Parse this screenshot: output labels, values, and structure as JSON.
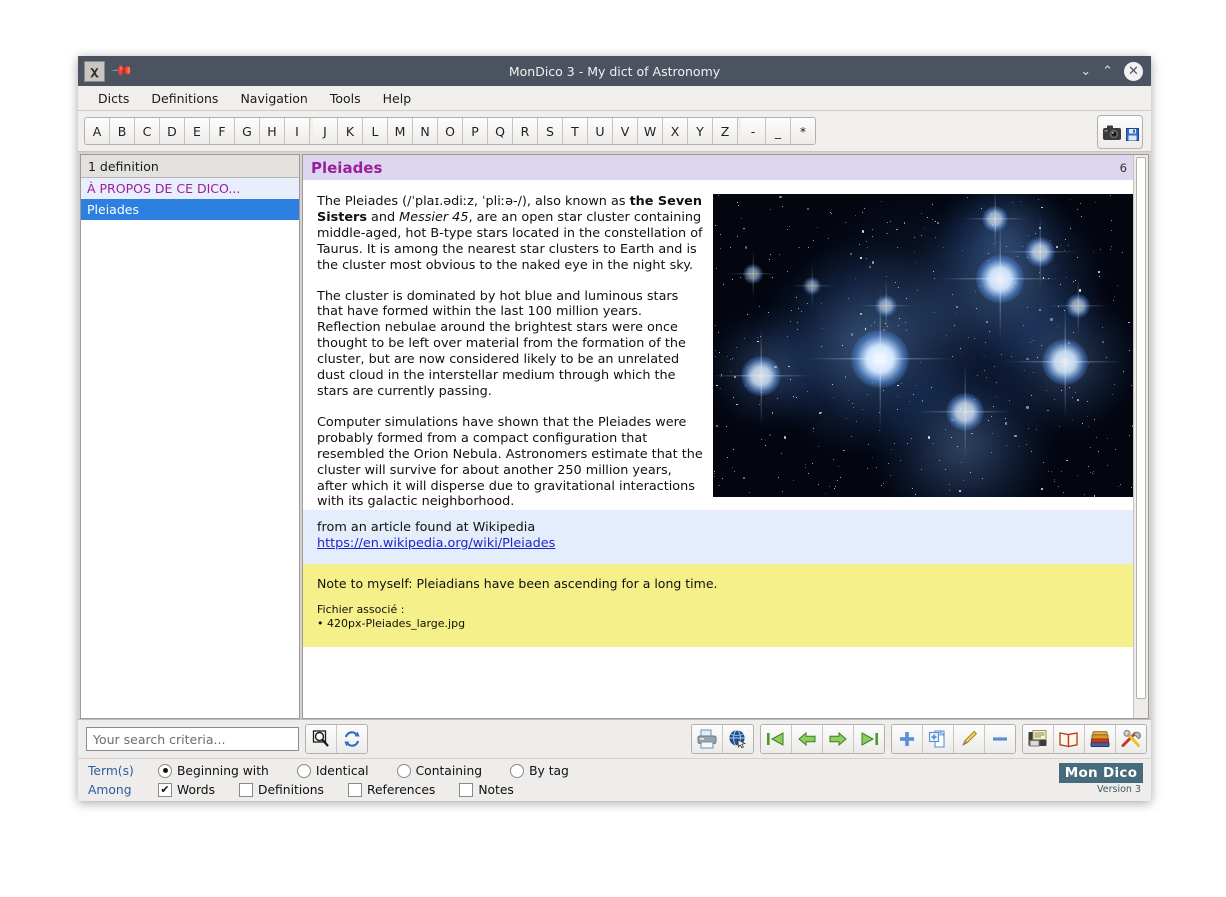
{
  "window": {
    "title": "MonDico 3 - My dict of Astronomy",
    "app_icon": "app-icon",
    "pin_icon": "pin-icon",
    "minimize_label": "⌄",
    "maximize_label": "⌃",
    "close_label": "✕"
  },
  "menubar": {
    "items": [
      {
        "label": "Dicts"
      },
      {
        "label": "Definitions"
      },
      {
        "label": "Navigation"
      },
      {
        "label": "Tools"
      },
      {
        "label": "Help"
      }
    ]
  },
  "alphabar": {
    "letters": [
      "A",
      "B",
      "C",
      "D",
      "E",
      "F",
      "G",
      "H",
      "I",
      "J",
      "K",
      "L",
      "M",
      "N",
      "O",
      "P",
      "Q",
      "R",
      "S",
      "T",
      "U",
      "V",
      "W",
      "X",
      "Y",
      "Z",
      "-",
      "_",
      "*"
    ],
    "capture_button": {
      "icon": "camera-icon",
      "save_icon": "floppy-disk-icon"
    }
  },
  "sidebar": {
    "header": "1 definition",
    "items": [
      {
        "label": "À PROPOS DE CE DICO...",
        "state": "about"
      },
      {
        "label": "Pleiades",
        "state": "selected"
      }
    ]
  },
  "entry": {
    "title": "Pleiades",
    "count": "6",
    "paragraphs": [
      "The Pleiades (/ˈplaɪ.ədiːz, ˈpliːə-/), also known as <b>the Seven Sisters</b> and <i>Messier 45</i>, are an open star cluster containing middle-aged, hot B-type stars located in the constellation of Taurus. It is among the nearest star clusters to Earth and is the cluster most obvious to the naked eye in the night sky.",
      "The cluster is dominated by hot blue and luminous stars that have formed within the last 100 million years. Reflection nebulae around the brightest stars were once thought to be left over material from the formation of the cluster, but are now considered likely to be an unrelated dust cloud in the interstellar medium through which the stars are currently passing.",
      "Computer simulations have shown that the Pleiades were probably formed from a compact configuration that resembled the Orion Nebula. Astronomers estimate that the cluster will survive for about another 250 million years, after which it will disperse due to gravitational interactions with its galactic neighborhood."
    ],
    "image_alt": "Pleiades star cluster photograph",
    "source": {
      "intro": "from an article found at Wikipedia",
      "link": "https://en.wikipedia.org/wiki/Pleiades"
    },
    "note": {
      "text": "Note to myself: Pleiadians have been ascending for a long time.",
      "file_label": "Fichier associé :",
      "file_name": "• 420px-Pleiades_large.jpg"
    }
  },
  "search": {
    "value": "",
    "placeholder": "Your search criteria...",
    "search_icon": "magnifier-icon",
    "refresh_icon": "refresh-icon"
  },
  "toolbar": {
    "buttons": [
      {
        "name": "print-button",
        "icon": "printer-icon"
      },
      {
        "name": "web-button",
        "icon": "globe-icon"
      },
      {
        "name": "first-button",
        "icon": "first-arrow-icon"
      },
      {
        "name": "previous-button",
        "icon": "left-arrow-icon"
      },
      {
        "name": "next-button",
        "icon": "right-arrow-icon"
      },
      {
        "name": "last-button",
        "icon": "last-arrow-icon"
      },
      {
        "name": "add-button",
        "icon": "plus-icon"
      },
      {
        "name": "duplicate-button",
        "icon": "copy-page-icon"
      },
      {
        "name": "edit-button",
        "icon": "pencil-icon"
      },
      {
        "name": "delete-button",
        "icon": "minus-icon"
      },
      {
        "name": "save-button",
        "icon": "save-disk-icon"
      },
      {
        "name": "book-button",
        "icon": "open-book-icon"
      },
      {
        "name": "dictionaries-button",
        "icon": "books-stack-icon"
      },
      {
        "name": "settings-button",
        "icon": "tools-icon"
      }
    ]
  },
  "options": {
    "terms_label": "Term(s)",
    "among_label": "Among",
    "terms": [
      {
        "label": "Beginning with",
        "selected": true
      },
      {
        "label": "Identical",
        "selected": false
      },
      {
        "label": "Containing",
        "selected": false
      },
      {
        "label": "By tag",
        "selected": false
      }
    ],
    "among": [
      {
        "label": "Words",
        "checked": true
      },
      {
        "label": "Definitions",
        "checked": false
      },
      {
        "label": "References",
        "checked": false
      },
      {
        "label": "Notes",
        "checked": false
      }
    ],
    "check_glyph": "✔"
  },
  "logo": {
    "name": "Mon Dico",
    "version": "Version 3"
  },
  "colors": {
    "titlebar": "#4c5360",
    "accent_purple": "#9b1f9b",
    "selection_blue": "#2d7fe0",
    "source_bg": "#e3edfb",
    "note_bg": "#f5f08a",
    "label_blue": "#2d5d9e",
    "logo_bg": "#456b7d"
  }
}
